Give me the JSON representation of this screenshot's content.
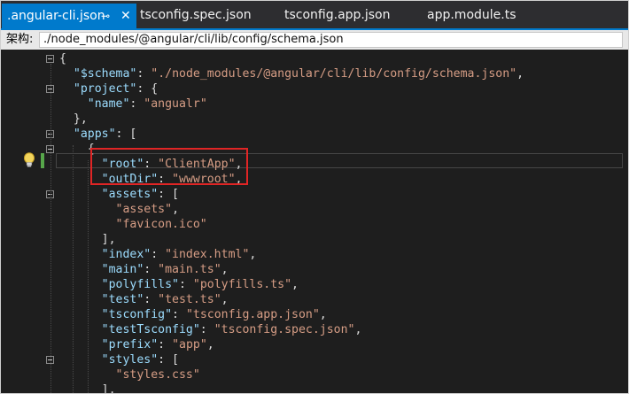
{
  "tabs": [
    {
      "label": ".angular-cli.json",
      "active": true,
      "pin_icon": "pin-icon",
      "close_icon": "close-icon"
    },
    {
      "label": "tsconfig.spec.json",
      "active": false
    },
    {
      "label": "tsconfig.app.json",
      "active": false
    },
    {
      "label": "app.module.ts",
      "active": false
    }
  ],
  "schema_bar": {
    "label": "架构:",
    "path": "./node_modules/@angular/cli/lib/config/schema.json"
  },
  "code_lines": [
    {
      "parts": [
        {
          "t": "{",
          "c": "punc"
        }
      ]
    },
    {
      "parts": [
        {
          "t": "  ",
          "c": "punc"
        },
        {
          "t": "\"$schema\"",
          "c": "key"
        },
        {
          "t": ": ",
          "c": "punc"
        },
        {
          "t": "\"./node_modules/@angular/cli/lib/config/schema.json\"",
          "c": "str"
        },
        {
          "t": ",",
          "c": "punc"
        }
      ]
    },
    {
      "parts": [
        {
          "t": "  ",
          "c": "punc"
        },
        {
          "t": "\"project\"",
          "c": "key"
        },
        {
          "t": ": {",
          "c": "punc"
        }
      ]
    },
    {
      "parts": [
        {
          "t": "    ",
          "c": "punc"
        },
        {
          "t": "\"name\"",
          "c": "key"
        },
        {
          "t": ": ",
          "c": "punc"
        },
        {
          "t": "\"angualr\"",
          "c": "str"
        }
      ]
    },
    {
      "parts": [
        {
          "t": "  },",
          "c": "punc"
        }
      ]
    },
    {
      "parts": [
        {
          "t": "  ",
          "c": "punc"
        },
        {
          "t": "\"apps\"",
          "c": "key"
        },
        {
          "t": ": [",
          "c": "punc"
        }
      ]
    },
    {
      "parts": [
        {
          "t": "    {",
          "c": "punc"
        }
      ]
    },
    {
      "parts": [
        {
          "t": "      ",
          "c": "punc"
        },
        {
          "t": "\"root\"",
          "c": "key"
        },
        {
          "t": ": ",
          "c": "punc"
        },
        {
          "t": "\"ClientApp\"",
          "c": "str"
        },
        {
          "t": ",",
          "c": "punc"
        }
      ]
    },
    {
      "parts": [
        {
          "t": "      ",
          "c": "punc"
        },
        {
          "t": "\"outDir\"",
          "c": "key"
        },
        {
          "t": ": ",
          "c": "punc"
        },
        {
          "t": "\"wwwroot\"",
          "c": "str"
        },
        {
          "t": ",",
          "c": "punc"
        }
      ]
    },
    {
      "parts": [
        {
          "t": "      ",
          "c": "punc"
        },
        {
          "t": "\"assets\"",
          "c": "key"
        },
        {
          "t": ": [",
          "c": "punc"
        }
      ]
    },
    {
      "parts": [
        {
          "t": "        ",
          "c": "punc"
        },
        {
          "t": "\"assets\"",
          "c": "str"
        },
        {
          "t": ",",
          "c": "punc"
        }
      ]
    },
    {
      "parts": [
        {
          "t": "        ",
          "c": "punc"
        },
        {
          "t": "\"favicon.ico\"",
          "c": "str"
        }
      ]
    },
    {
      "parts": [
        {
          "t": "      ],",
          "c": "punc"
        }
      ]
    },
    {
      "parts": [
        {
          "t": "      ",
          "c": "punc"
        },
        {
          "t": "\"index\"",
          "c": "key"
        },
        {
          "t": ": ",
          "c": "punc"
        },
        {
          "t": "\"index.html\"",
          "c": "str"
        },
        {
          "t": ",",
          "c": "punc"
        }
      ]
    },
    {
      "parts": [
        {
          "t": "      ",
          "c": "punc"
        },
        {
          "t": "\"main\"",
          "c": "key"
        },
        {
          "t": ": ",
          "c": "punc"
        },
        {
          "t": "\"main.ts\"",
          "c": "str"
        },
        {
          "t": ",",
          "c": "punc"
        }
      ]
    },
    {
      "parts": [
        {
          "t": "      ",
          "c": "punc"
        },
        {
          "t": "\"polyfills\"",
          "c": "key"
        },
        {
          "t": ": ",
          "c": "punc"
        },
        {
          "t": "\"polyfills.ts\"",
          "c": "str"
        },
        {
          "t": ",",
          "c": "punc"
        }
      ]
    },
    {
      "parts": [
        {
          "t": "      ",
          "c": "punc"
        },
        {
          "t": "\"test\"",
          "c": "key"
        },
        {
          "t": ": ",
          "c": "punc"
        },
        {
          "t": "\"test.ts\"",
          "c": "str"
        },
        {
          "t": ",",
          "c": "punc"
        }
      ]
    },
    {
      "parts": [
        {
          "t": "      ",
          "c": "punc"
        },
        {
          "t": "\"tsconfig\"",
          "c": "key"
        },
        {
          "t": ": ",
          "c": "punc"
        },
        {
          "t": "\"tsconfig.app.json\"",
          "c": "str"
        },
        {
          "t": ",",
          "c": "punc"
        }
      ]
    },
    {
      "parts": [
        {
          "t": "      ",
          "c": "punc"
        },
        {
          "t": "\"testTsconfig\"",
          "c": "key"
        },
        {
          "t": ": ",
          "c": "punc"
        },
        {
          "t": "\"tsconfig.spec.json\"",
          "c": "str"
        },
        {
          "t": ",",
          "c": "punc"
        }
      ]
    },
    {
      "parts": [
        {
          "t": "      ",
          "c": "punc"
        },
        {
          "t": "\"prefix\"",
          "c": "key"
        },
        {
          "t": ": ",
          "c": "punc"
        },
        {
          "t": "\"app\"",
          "c": "str"
        },
        {
          "t": ",",
          "c": "punc"
        }
      ]
    },
    {
      "parts": [
        {
          "t": "      ",
          "c": "punc"
        },
        {
          "t": "\"styles\"",
          "c": "key"
        },
        {
          "t": ": [",
          "c": "punc"
        }
      ]
    },
    {
      "parts": [
        {
          "t": "        ",
          "c": "punc"
        },
        {
          "t": "\"styles.css\"",
          "c": "str"
        }
      ]
    },
    {
      "parts": [
        {
          "t": "      ],",
          "c": "punc"
        }
      ]
    }
  ],
  "colors": {
    "tab_active": "#007acc",
    "editor_bg": "#1e1e1e",
    "json_key": "#9cdcfe",
    "json_string": "#d69d85",
    "annotation_box": "#e02525",
    "change_bar": "#57a64a"
  },
  "icons": [
    "pin-icon",
    "close-icon",
    "lightbulb-icon",
    "fold-toggle-icon"
  ]
}
